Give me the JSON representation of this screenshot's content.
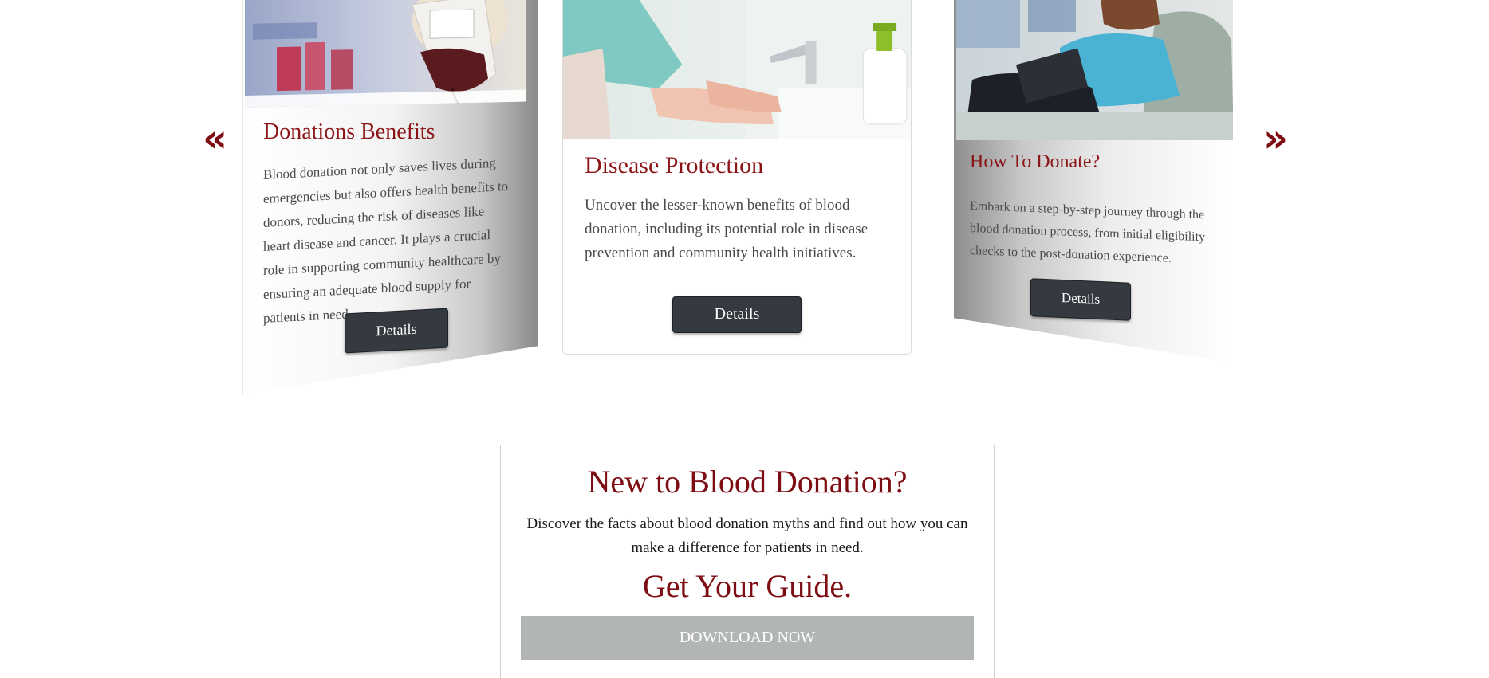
{
  "carousel": {
    "prev_icon": "«",
    "next_icon": "»",
    "cards": [
      {
        "title": "Donations Benefits",
        "text": "Blood donation not only saves lives during emergencies but also offers health benefits to donors, reducing the risk of diseases like heart disease and cancer. It plays a crucial role in supporting community healthcare by ensuring an adequate blood supply for patients in need.",
        "button": "Details",
        "image_subject": "blood-bag-photo"
      },
      {
        "title": "Disease Protection",
        "text": "Uncover the lesser-known benefits of blood donation, including its potential role in disease prevention and community health initiatives.",
        "button": "Details",
        "image_subject": "hand-washing-photo"
      },
      {
        "title": "How To Donate?",
        "text": "Embark on a step-by-step journey through the blood donation process, from initial eligibility checks to the post-donation experience.",
        "button": "Details",
        "image_subject": "donor-in-chair-photo"
      }
    ]
  },
  "guide": {
    "heading": "New to Blood Donation?",
    "text": "Discover the facts about blood donation myths and find out how you can make a difference for patients in need.",
    "subheading": "Get Your Guide.",
    "button": "DOWNLOAD NOW"
  },
  "colors": {
    "accent": "#7d0d12",
    "button_dark": "#343a40",
    "download_button": "#b2b6b3"
  }
}
